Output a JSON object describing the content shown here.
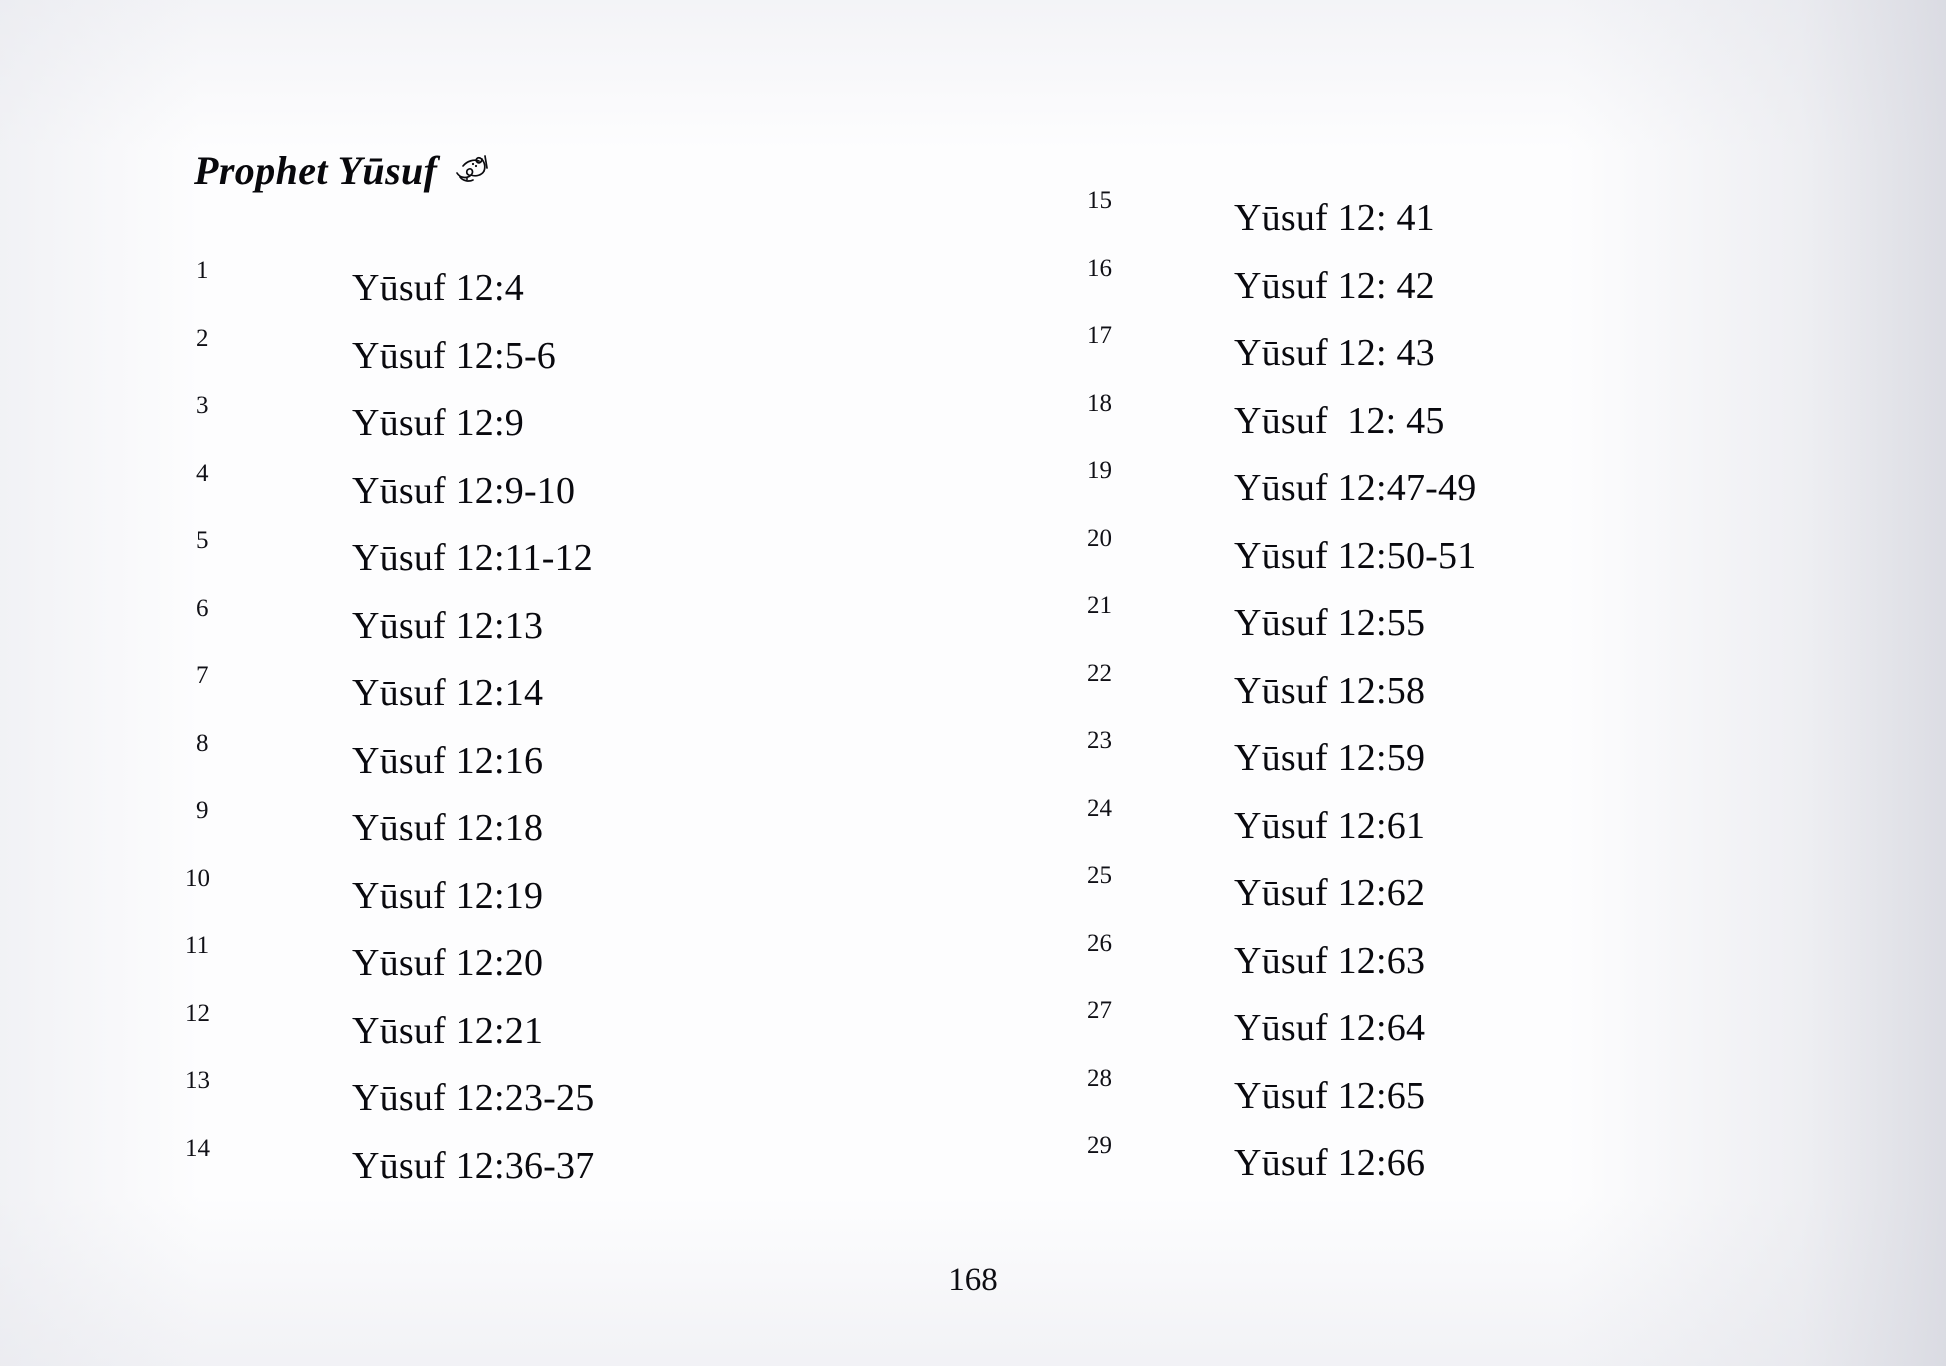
{
  "page": {
    "heading": "Prophet Yūsuf",
    "honorific_icon": "arabic-honorific-alayhi-assalam",
    "page_number": "168",
    "background_color": "#fdfdfe",
    "text_color": "#09090e"
  },
  "left_column": {
    "entries": [
      {
        "num": "1",
        "ref": "Yūsuf 12:4"
      },
      {
        "num": "2",
        "ref": "Yūsuf 12:5-6"
      },
      {
        "num": "3",
        "ref": "Yūsuf 12:9"
      },
      {
        "num": "4",
        "ref": "Yūsuf 12:9-10"
      },
      {
        "num": "5",
        "ref": "Yūsuf 12:11-12"
      },
      {
        "num": "6",
        "ref": "Yūsuf 12:13"
      },
      {
        "num": "7",
        "ref": "Yūsuf 12:14"
      },
      {
        "num": "8",
        "ref": "Yūsuf 12:16"
      },
      {
        "num": "9",
        "ref": "Yūsuf 12:18"
      },
      {
        "num": "10",
        "ref": "Yūsuf 12:19"
      },
      {
        "num": "11",
        "ref": "Yūsuf 12:20"
      },
      {
        "num": "12",
        "ref": "Yūsuf 12:21"
      },
      {
        "num": "13",
        "ref": "Yūsuf 12:23-25"
      },
      {
        "num": "14",
        "ref": "Yūsuf 12:36-37"
      }
    ]
  },
  "right_column": {
    "entries": [
      {
        "num": "15",
        "ref": "Yūsuf 12: 41"
      },
      {
        "num": "16",
        "ref": "Yūsuf 12: 42"
      },
      {
        "num": "17",
        "ref": "Yūsuf 12: 43"
      },
      {
        "num": "18",
        "ref": "Yūsuf  12: 45"
      },
      {
        "num": "19",
        "ref": "Yūsuf 12:47-49"
      },
      {
        "num": "20",
        "ref": "Yūsuf 12:50-51"
      },
      {
        "num": "21",
        "ref": "Yūsuf 12:55"
      },
      {
        "num": "22",
        "ref": "Yūsuf 12:58"
      },
      {
        "num": "23",
        "ref": "Yūsuf 12:59"
      },
      {
        "num": "24",
        "ref": "Yūsuf 12:61"
      },
      {
        "num": "25",
        "ref": "Yūsuf 12:62"
      },
      {
        "num": "26",
        "ref": "Yūsuf 12:63"
      },
      {
        "num": "27",
        "ref": "Yūsuf 12:64"
      },
      {
        "num": "28",
        "ref": "Yūsuf 12:65"
      },
      {
        "num": "29",
        "ref": "Yūsuf 12:66"
      }
    ]
  }
}
